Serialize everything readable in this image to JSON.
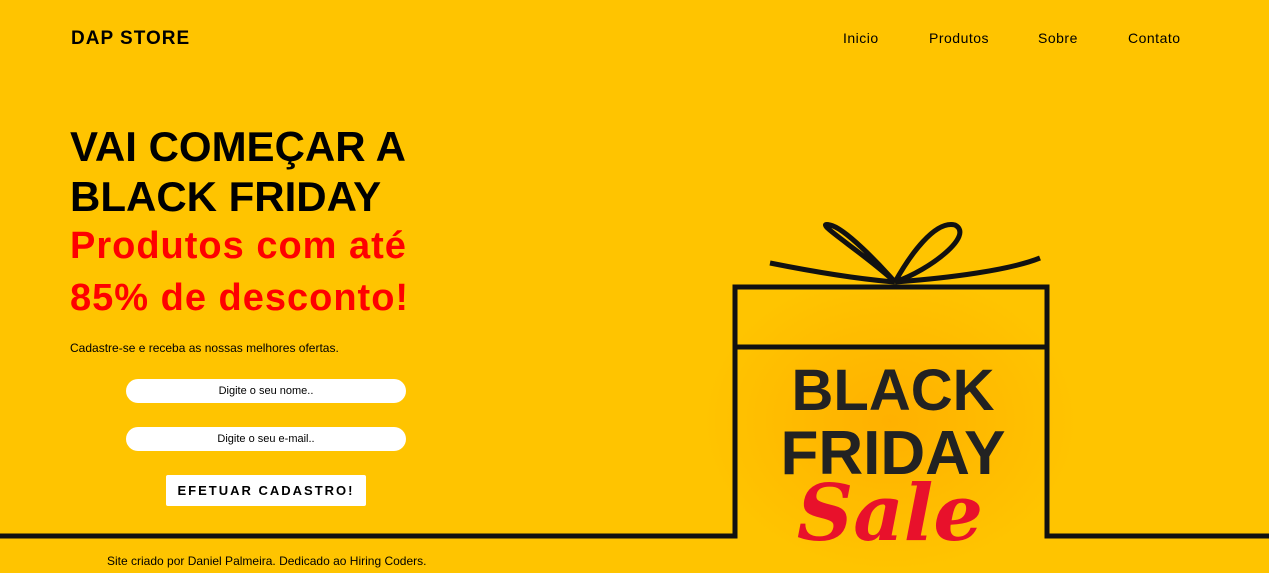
{
  "header": {
    "logo": "DAP STORE",
    "nav": [
      "Inicio",
      "Produtos",
      "Sobre",
      "Contato"
    ]
  },
  "hero": {
    "headline": "VAI COMEÇAR A BLACK FRIDAY",
    "subheadline": "Produtos com até 85% de desconto!",
    "tagline": "Cadastre-se e receba as nossas melhores ofertas."
  },
  "form": {
    "name_placeholder": "Digite o seu nome..",
    "email_placeholder": "Digite o seu e-mail..",
    "submit_label": "EFETUAR CADASTRO!"
  },
  "artwork": {
    "line1": "BLACK",
    "line2": "FRIDAY",
    "line3": "Sale"
  },
  "footer": {
    "text": "Site criado por Daniel Palmeira. Dedicado ao Hiring Coders."
  },
  "colors": {
    "background": "#ffc400",
    "accent_red": "#ff0000",
    "text": "#000000"
  }
}
